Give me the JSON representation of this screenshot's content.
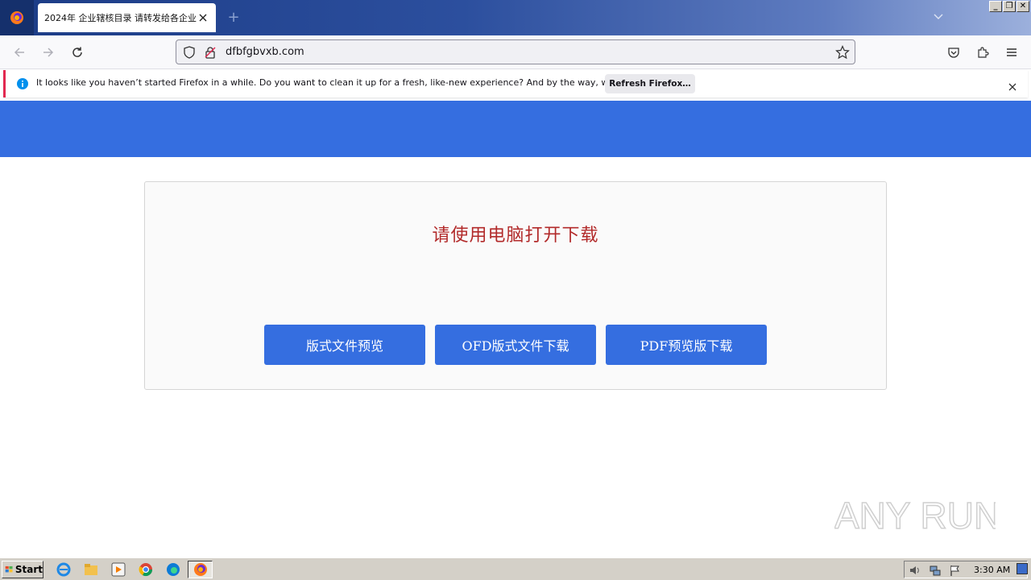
{
  "browser": {
    "tab": {
      "title": "2024年 企业辖核目录 请转发给各企业"
    },
    "url": "dfbfgbvxb.com",
    "window_controls": [
      "_",
      "❐",
      "✕"
    ]
  },
  "notification": {
    "message": "It looks like you haven’t started Firefox in a while. Do you want to clean it up for a fresh, like-new experience? And by the way, welcome back!",
    "button_label": "Refresh Firefox…"
  },
  "page": {
    "title": "请使用电脑打开下载",
    "buttons": [
      "版式文件预览",
      "OFD版式文件下载",
      "PDF预览版下载"
    ]
  },
  "watermark": "ANY RUN",
  "taskbar": {
    "start_label": "Start",
    "clock": "3:30 AM"
  },
  "colors": {
    "accent": "#356ee0",
    "title_red": "#b22a2a",
    "notification_stripe": "#e22850"
  }
}
